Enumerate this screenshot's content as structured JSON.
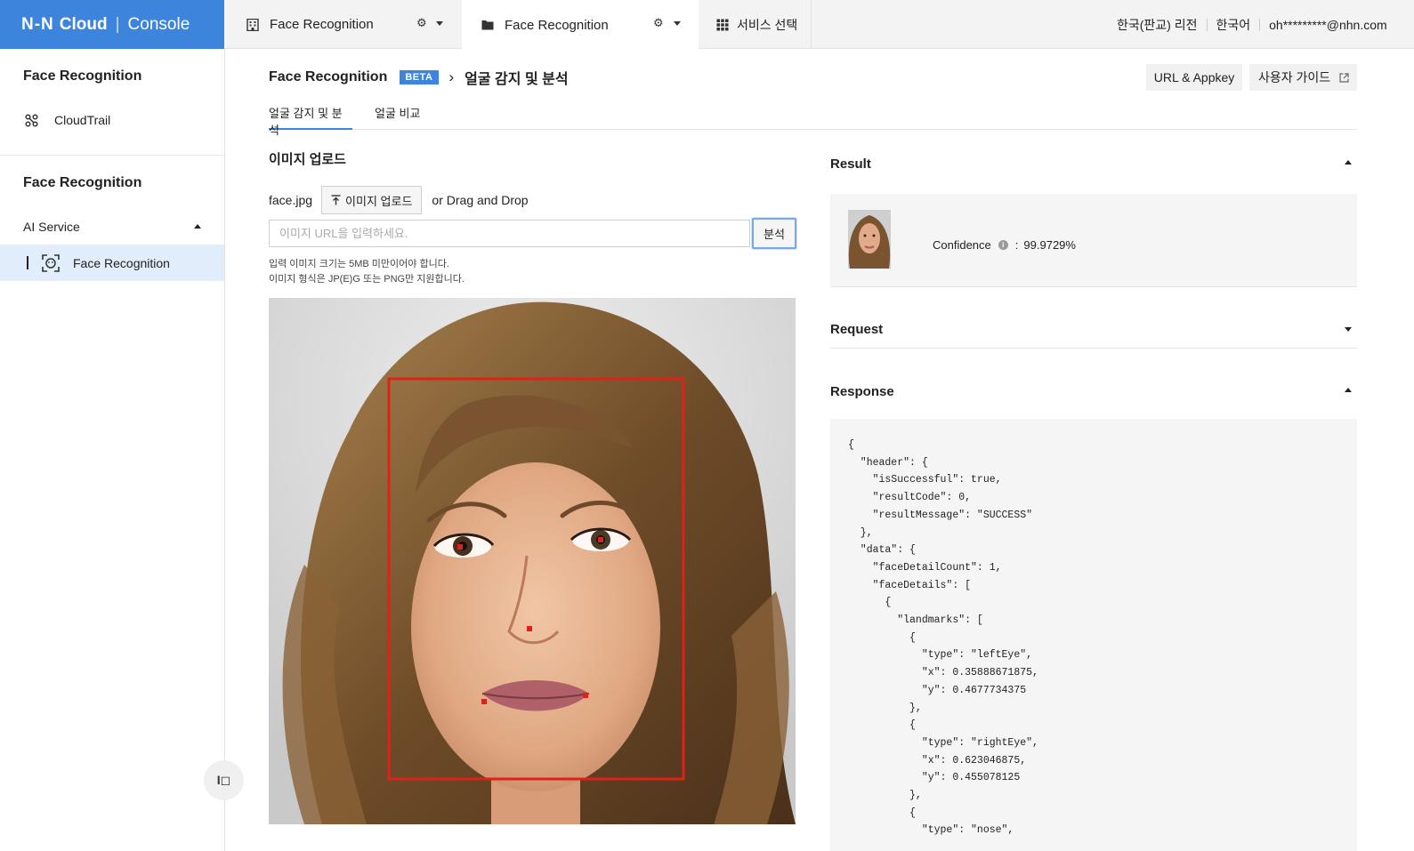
{
  "header": {
    "logo_nhn": "N-N",
    "logo_cloud": "Cloud",
    "logo_console": "Console",
    "project_tab_1": "Face Recognition",
    "project_tab_2": "Face Recognition",
    "service_select": "서비스 선택",
    "region": "한국(판교) 리전",
    "language": "한국어",
    "account": "oh*********@nhn.com"
  },
  "sidebar": {
    "org_title": "Face Recognition",
    "cloudtrail": "CloudTrail",
    "project_title": "Face Recognition",
    "group_label": "AI Service",
    "active_item": "Face Recognition",
    "collapse_glyph": "I◻"
  },
  "main": {
    "breadcrumb_service": "Face Recognition",
    "beta_badge": "BETA",
    "breadcrumb_sep": "›",
    "breadcrumb_page": "얼굴 감지 및 분석",
    "url_appkey_button": "URL & Appkey",
    "user_guide_button": "사용자 가이드",
    "tabs": [
      {
        "label": "얼굴 감지 및 분석",
        "active": true
      },
      {
        "label": "얼굴 비교",
        "active": false
      }
    ],
    "upload_section_title": "이미지 업로드",
    "file_name": "face.jpg",
    "upload_button": "이미지 업로드",
    "drag_drop_text": "or Drag and Drop",
    "url_placeholder": "이미지 URL을 입력하세요.",
    "url_value": "",
    "analyze_button": "분석",
    "hint_1": "입력 이미지 크기는 5MB 미만이어야 합니다.",
    "hint_2": "이미지 형식은 JP(E)G 또는 PNG만 지원합니다."
  },
  "result": {
    "title": "Result",
    "expanded": true,
    "confidence_label": "Confidence",
    "confidence_separator": ":",
    "confidence_value": "99.9729%"
  },
  "request": {
    "title": "Request",
    "expanded": false
  },
  "response": {
    "title": "Response",
    "expanded": true,
    "json_text": "{\n  \"header\": {\n    \"isSuccessful\": true,\n    \"resultCode\": 0,\n    \"resultMessage\": \"SUCCESS\"\n  },\n  \"data\": {\n    \"faceDetailCount\": 1,\n    \"faceDetails\": [\n      {\n        \"landmarks\": [\n          {\n            \"type\": \"leftEye\",\n            \"x\": 0.35888671875,\n            \"y\": 0.4677734375\n          },\n          {\n            \"type\": \"rightEye\",\n            \"x\": 0.623046875,\n            \"y\": 0.455078125\n          },\n          {\n            \"type\": \"nose\","
  },
  "colors": {
    "brand": "#3d85dc",
    "detection_box": "#e0201b",
    "active_nav_bg": "#e1edfb"
  }
}
